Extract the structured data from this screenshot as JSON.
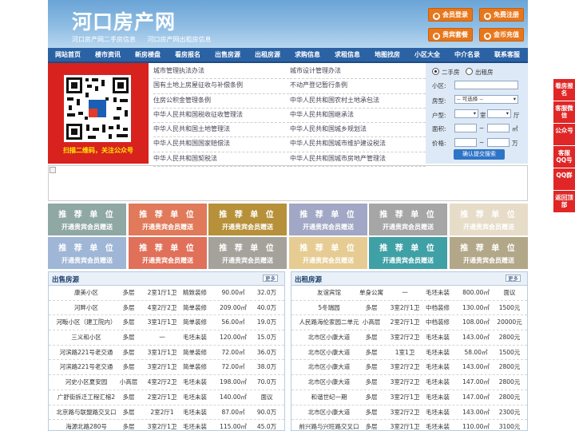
{
  "site": {
    "logo": "河口房产网",
    "subtitles": [
      "河口房产网二手房信息",
      "河口房产网出租房信息"
    ]
  },
  "header_buttons": [
    "会员登录",
    "免费注册",
    "贵宾套餐",
    "金币充值"
  ],
  "nav": [
    "网站首页",
    "楼市资讯",
    "新房楼盘",
    "看房报名",
    "出售房源",
    "出租房源",
    "求购信息",
    "求租信息",
    "地图找房",
    "小区大全",
    "中介名录",
    "联系客服"
  ],
  "qr_caption": "扫描二维码，关注公众号",
  "links_left": [
    "城市管理执法办法",
    "国有土地上房屋征收与补偿条例",
    "住房公积金管理条例",
    "中华人民共和国税收征收管理法",
    "中华人民共和国土地管理法",
    "中华人民共和国国家赔偿法",
    "中华人民共和国契税法"
  ],
  "links_right": [
    "城市设计管理办法",
    "不动产登记暂行条例",
    "中华人民共和国农村土地承包法",
    "中华人民共和国继承法",
    "中华人民共和国城乡规划法",
    "中华人民共和国城市维护建设税法",
    "中华人民共和国城市房地产管理法"
  ],
  "search": {
    "radio": [
      "二手房",
      "出租房"
    ],
    "labels": [
      "小区:",
      "房型:",
      "户型:",
      "面积:",
      "价格:"
    ],
    "select": "-- 可选择 --",
    "unit_room": "室",
    "unit_hall": "厅",
    "unit_area": "㎡",
    "unit_price": "万",
    "tilde": "~",
    "button": "确认提交搜索"
  },
  "ads": {
    "title": "推 荐 单 位",
    "sub": "开通贵宾会员赠送",
    "colors": [
      "#8fa8a4",
      "#e07a5a",
      "#b7903a",
      "#a1a7c4",
      "#a6a6a6",
      "#e6dcc8",
      "#9fb6d6",
      "#e0705a",
      "#a5a29c",
      "#e6cc93",
      "#3fa0a6",
      "#b2a788"
    ]
  },
  "sale": {
    "title": "出售房源",
    "more": "更多",
    "rows": [
      [
        "康美小区",
        "多层",
        "2室1厅1卫",
        "精致装修",
        "90.00㎡",
        "32.0万"
      ],
      [
        "河畔小区",
        "多层",
        "4室2厅2卫",
        "简单装修",
        "209.00㎡",
        "40.0万"
      ],
      [
        "河畈小区（建工院内）",
        "多层",
        "3室1厅1卫",
        "简单装修",
        "56.00㎡",
        "19.0万"
      ],
      [
        "三义和小区",
        "多层",
        "一",
        "毛坯未装",
        "120.00㎡",
        "15.0万"
      ],
      [
        "河滨路221号老交通",
        "多层",
        "3室1厅1卫",
        "简单装修",
        "72.00㎡",
        "36.0万"
      ],
      [
        "河滨路221号老交通",
        "多层",
        "3室2厅1卫",
        "简单装修",
        "72.00㎡",
        "38.0万"
      ],
      [
        "河史小区夏安园",
        "小高层",
        "4室2厅2卫",
        "毛坯未装",
        "198.00㎡",
        "70.0万"
      ],
      [
        "广舒街拆迁工程汇榕2",
        "多层",
        "2室2厅1卫",
        "毛坯未装",
        "140.00㎡",
        "面议"
      ],
      [
        "北京路与联盟路交叉口",
        "多层",
        "2室2厅1",
        "毛坯未装",
        "87.00㎡",
        "90.0万"
      ],
      [
        "海源北路280号",
        "多层",
        "3室2厅1卫",
        "毛坯未装",
        "115.00㎡",
        "45.0万"
      ]
    ]
  },
  "rent": {
    "title": "出租房源",
    "more": "更多",
    "rows": [
      [
        "友谊宾馆",
        "单身公寓",
        "一",
        "毛坯未装",
        "800.00㎡",
        "面议"
      ],
      [
        "5冬瑞园",
        "多层",
        "3室2厅1卫",
        "中档装修",
        "130.00㎡",
        "1500元"
      ],
      [
        "人民路海伦家园二单元",
        "小高层",
        "2室2厅1卫",
        "中档装修",
        "108.00㎡",
        "20000元"
      ],
      [
        "北市区小康大道",
        "多层",
        "3室2厅2卫",
        "毛坯未装",
        "143.00㎡",
        "2800元"
      ],
      [
        "北市区小康大道",
        "多层",
        "1室1卫",
        "毛坯未装",
        "58.00㎡",
        "1500元"
      ],
      [
        "北市区小康大道",
        "多层",
        "3室2厅2卫",
        "毛坯未装",
        "143.00㎡",
        "2800元"
      ],
      [
        "北市区小康大道",
        "多层",
        "3室2厅2卫",
        "毛坯未装",
        "147.00㎡",
        "2800元"
      ],
      [
        "和谐世纪一期",
        "多层",
        "3室2厅1卫",
        "毛坯未装",
        "147.00㎡",
        "2800元"
      ],
      [
        "北市区小康大道",
        "多层",
        "3室2厅2卫",
        "毛坯未装",
        "143.00㎡",
        "2300元"
      ],
      [
        "前兴路与兴旺路交叉口",
        "多层",
        "3室2厅1卫",
        "毛坯未装",
        "110.00㎡",
        "3100元"
      ]
    ]
  },
  "side_buttons": [
    "看房报名",
    "客服微信",
    "公众号",
    "客服QQ号",
    "QQ群",
    "返回顶部"
  ]
}
